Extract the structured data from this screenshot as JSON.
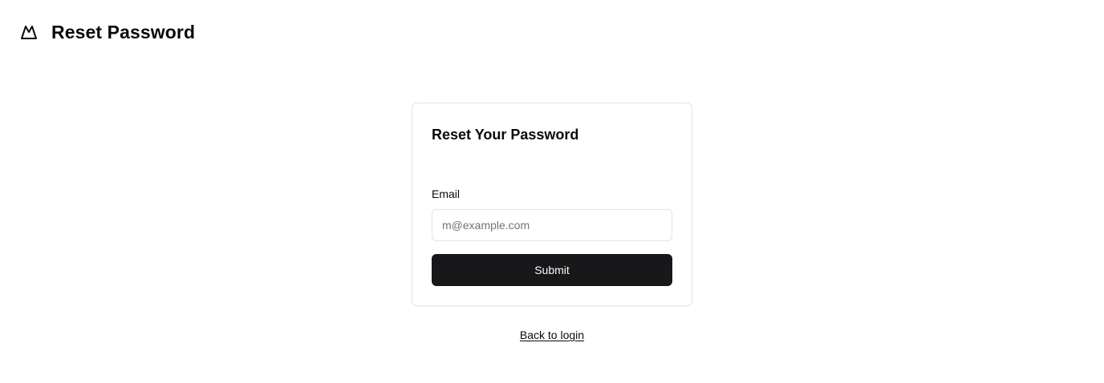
{
  "header": {
    "logo_icon": "mountain-icon",
    "title": "Reset Password"
  },
  "card": {
    "title": "Reset Your Password",
    "email": {
      "label": "Email",
      "value": "",
      "placeholder": "m@example.com"
    },
    "submit_label": "Submit"
  },
  "footer": {
    "back_link_label": "Back to login"
  },
  "colors": {
    "primary_button": "#18181b",
    "border": "#e4e4e7",
    "text": "#0a0a0a",
    "placeholder": "#737373"
  }
}
